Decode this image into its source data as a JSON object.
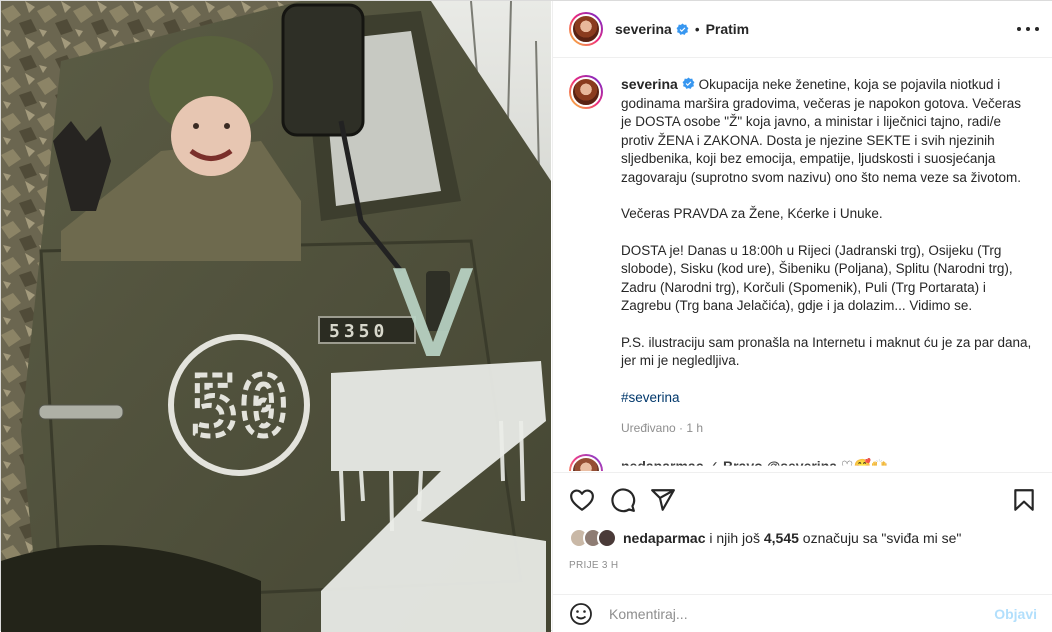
{
  "post": {
    "username": "severina",
    "follow_label": "Pratim",
    "separator": "•"
  },
  "photo": {
    "truck_number": "5350",
    "door_number": "50",
    "z_letter": "Z",
    "v_letter": "V"
  },
  "caption": {
    "username": "severina",
    "paragraphs": [
      "Okupacija neke ženetine, koja se pojavila niotkud i godinama maršira gradovima, večeras je napokon gotova. Večeras je DOSTA osobe \"Ž\" koja javno, a ministar i liječnici tajno, radi/e protiv ŽENA i ZAKONA. Dosta je njezine SEKTE i svih njezinih sljedbenika, koji bez emocija, empatije, ljudskosti i suosjećanja zagovaraju (suprotno svom nazivu) ono što nema veze sa životom.",
      "Večeras PRAVDA za Žene, Kćerke i Unuke.",
      "DOSTA je! Danas u 18:00h u Rijeci (Jadranski trg), Osijeku (Trg slobode), Sisku (kod ure), Šibeniku (Poljana), Splitu (Narodni trg), Zadru (Narodni trg), Korčuli (Spomenik), Puli (Trg Portarata) i Zagrebu (Trg bana Jelačića), gdje i ja dolazim... Vidimo se.",
      "P.S. ilustraciju sam pronašla na Internetu i maknut ću je za par dana, jer mi je negledljiva."
    ],
    "hashtag": "#severina",
    "edited_label": "Uređivano",
    "edited_time": "1 h"
  },
  "next_comment": {
    "preview": "nedaparmac ✓ Bravo @severina ♡🥰🙌"
  },
  "likes": {
    "first_liker": "nedaparmac",
    "connector": "i njih još",
    "count": "4,545",
    "suffix": "označuju sa \"sviđa mi se\""
  },
  "date_label": "PRIJE 3 H",
  "comment_box": {
    "placeholder": "Komentiraj...",
    "post_label": "Objavi"
  },
  "icons": {
    "like": "heart-icon",
    "comment": "comment-bubble-icon",
    "share": "paper-plane-icon",
    "save": "bookmark-icon",
    "emoji": "smiley-icon",
    "more": "more-dots-icon",
    "verified": "verified-badge-icon"
  },
  "colors": {
    "verified": "#3897f0",
    "link": "#00376b",
    "muted": "#8e8e8e",
    "post_disabled": "#b2dffc"
  }
}
